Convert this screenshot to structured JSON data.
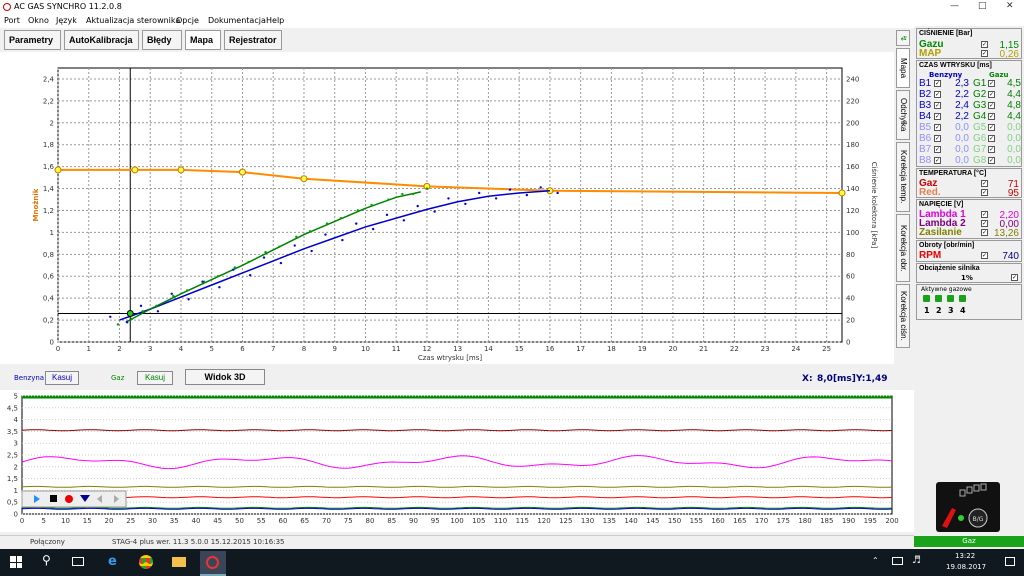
{
  "window": {
    "title": "AC GAS SYNCHRO  11.2.0.8"
  },
  "menu": [
    "Port",
    "Okno",
    "Język",
    "Aktualizacja sterownika",
    "Opcje",
    "Dokumentacja",
    "Help"
  ],
  "tabs": [
    "Parametry",
    "AutoKalibracja",
    "Błędy",
    "Mapa",
    "Rejestrator"
  ],
  "side_tabs": [
    "Mapa",
    "Odchyłka",
    "Korekcja temp.",
    "Korekcja obr.",
    "Korekcja ciśn."
  ],
  "toolbar": {
    "benzyna_label": "Benzyna",
    "kasuj1": "Kasuj",
    "gaz_label": "Gaz",
    "kasuj2": "Kasuj",
    "widok3d": "Widok 3D",
    "cursor_x_label": "X:",
    "cursor_x": "8,0[ms]",
    "cursor_y": "Y:1,49"
  },
  "pressure": {
    "header": "CIŚNIENIE [Bar]",
    "gazu_label": "Gazu",
    "gazu_value": "1,15",
    "map_label": "MAP",
    "map_value": "0,26"
  },
  "injection": {
    "header": "CZAS WTRYSKU  [ms]",
    "benzyny": "Benzyny",
    "gazu": "Gazu",
    "rows": [
      {
        "b": "B1",
        "bv": "2,3",
        "g": "G1",
        "gv": "4,5"
      },
      {
        "b": "B2",
        "bv": "2,2",
        "g": "G2",
        "gv": "4,4"
      },
      {
        "b": "B3",
        "bv": "2,4",
        "g": "G3",
        "gv": "4,8"
      },
      {
        "b": "B4",
        "bv": "2,2",
        "g": "G4",
        "gv": "4,4"
      },
      {
        "b": "B5",
        "bv": "0,0",
        "g": "G5",
        "gv": "0,0"
      },
      {
        "b": "B6",
        "bv": "0,0",
        "g": "G6",
        "gv": "0,0"
      },
      {
        "b": "B7",
        "bv": "0,0",
        "g": "G7",
        "gv": "0,0"
      },
      {
        "b": "B8",
        "bv": "0,0",
        "g": "G8",
        "gv": "0,0"
      }
    ]
  },
  "temperature": {
    "header": "TEMPERATURA  [°C]",
    "gaz_label": "Gaz",
    "gaz_value": "71",
    "red_label": "Red.",
    "red_value": "95"
  },
  "voltage": {
    "header": "NAPIĘCIE [V]",
    "l1_label": "Lambda 1",
    "l1_value": "2,20",
    "l2_label": "Lambda 2",
    "l2_value": "0,00",
    "zas_label": "Zasilanie",
    "zas_value": "13,26"
  },
  "rpm": {
    "header": "Obroty [obr/min]",
    "label": "RPM",
    "value": "740"
  },
  "load": {
    "header": "Obciążenie silnika",
    "value": "1%"
  },
  "active_gas": {
    "header": "Aktywne gazowe",
    "nums": [
      "1",
      "2",
      "3",
      "4"
    ]
  },
  "status": {
    "connection": "Połączony",
    "device": "STAG-4 plus  wer. 11.3  5.0.0    15.12.2015 10:16:35",
    "fuel": "Gaz",
    "badge": "B/G"
  },
  "taskbar": {
    "time": "13:22",
    "date": "19.08.2017"
  },
  "colors": {
    "gas": "#008000",
    "benzyna": "#0000cc",
    "map_line": "#ff8c00",
    "lambda": "#ff00ff"
  },
  "chart_data": [
    {
      "type": "scatter",
      "xlabel": "Czas wtrysku [ms]",
      "ylabel": "Mnożnik",
      "y2label": "Ciśnienie kolektora [kPa]",
      "xlim": [
        0,
        25.5
      ],
      "ylim": [
        0,
        2.5
      ],
      "y2lim": [
        0,
        250
      ],
      "x_ticks": [
        0,
        1,
        2,
        3,
        4,
        5,
        6,
        7,
        8,
        9,
        10,
        11,
        12,
        13,
        14,
        15,
        16,
        17,
        18,
        19,
        20,
        21,
        22,
        23,
        24,
        25
      ],
      "y_ticks": [
        "0",
        "0,2",
        "0,4",
        "0,6",
        "0,8",
        "1",
        "1,2",
        "1,4",
        "1,6",
        "1,8",
        "2",
        "2,2",
        "2,4"
      ],
      "y2_ticks": [
        0,
        20,
        40,
        60,
        80,
        100,
        120,
        140,
        160,
        180,
        200,
        220,
        240
      ],
      "grid": true,
      "multiplier_curve": {
        "name": "",
        "x": [
          0,
          2.5,
          4,
          6,
          8,
          12,
          16,
          25.5
        ],
        "y": [
          1.57,
          1.57,
          1.57,
          1.55,
          1.49,
          1.42,
          1.38,
          1.36
        ],
        "nodes_x": [
          0,
          2.5,
          4,
          6,
          8,
          12,
          16,
          25.5
        ]
      },
      "gas_curve": {
        "x": [
          2.2,
          3,
          4,
          5,
          6,
          7,
          8,
          9,
          10,
          11,
          11.8
        ],
        "y": [
          0.18,
          0.3,
          0.44,
          0.57,
          0.7,
          0.84,
          0.98,
          1.1,
          1.22,
          1.32,
          1.37
        ]
      },
      "benzyna_curve": {
        "x": [
          2,
          3,
          4,
          5,
          6,
          7,
          8,
          9,
          10,
          11,
          12,
          13,
          14,
          15,
          16
        ],
        "y": [
          0.2,
          0.3,
          0.41,
          0.52,
          0.63,
          0.74,
          0.85,
          0.95,
          1.05,
          1.13,
          1.21,
          1.28,
          1.33,
          1.36,
          1.38
        ]
      },
      "cursor": {
        "x": 2.35,
        "y": 0.26
      }
    },
    {
      "type": "line",
      "xlim": [
        0,
        200
      ],
      "ylim": [
        0,
        5
      ],
      "x_ticks": [
        0,
        5,
        10,
        15,
        20,
        25,
        30,
        35,
        40,
        45,
        50,
        55,
        60,
        65,
        70,
        75,
        80,
        85,
        90,
        95,
        100,
        105,
        110,
        115,
        120,
        125,
        130,
        135,
        140,
        145,
        150,
        155,
        160,
        165,
        170,
        175,
        180,
        185,
        190,
        195,
        200
      ],
      "y_ticks": [
        "0",
        "0,5",
        "1",
        "1,5",
        "2",
        "2,5",
        "3",
        "3,5",
        "4",
        "4,5",
        "5"
      ],
      "series": [
        {
          "name": "",
          "color": "#8b0000",
          "level": 3.55
        },
        {
          "name": "",
          "color": "#ff00ff",
          "level": 2.2
        },
        {
          "name": "",
          "color": "#808000",
          "level": 1.15
        },
        {
          "name": "",
          "color": "#ff0000",
          "level": 0.71
        },
        {
          "name": "",
          "color": "#008000",
          "level": 0.26
        },
        {
          "name": "",
          "color": "#0000cc",
          "level": 0.22
        }
      ]
    }
  ]
}
